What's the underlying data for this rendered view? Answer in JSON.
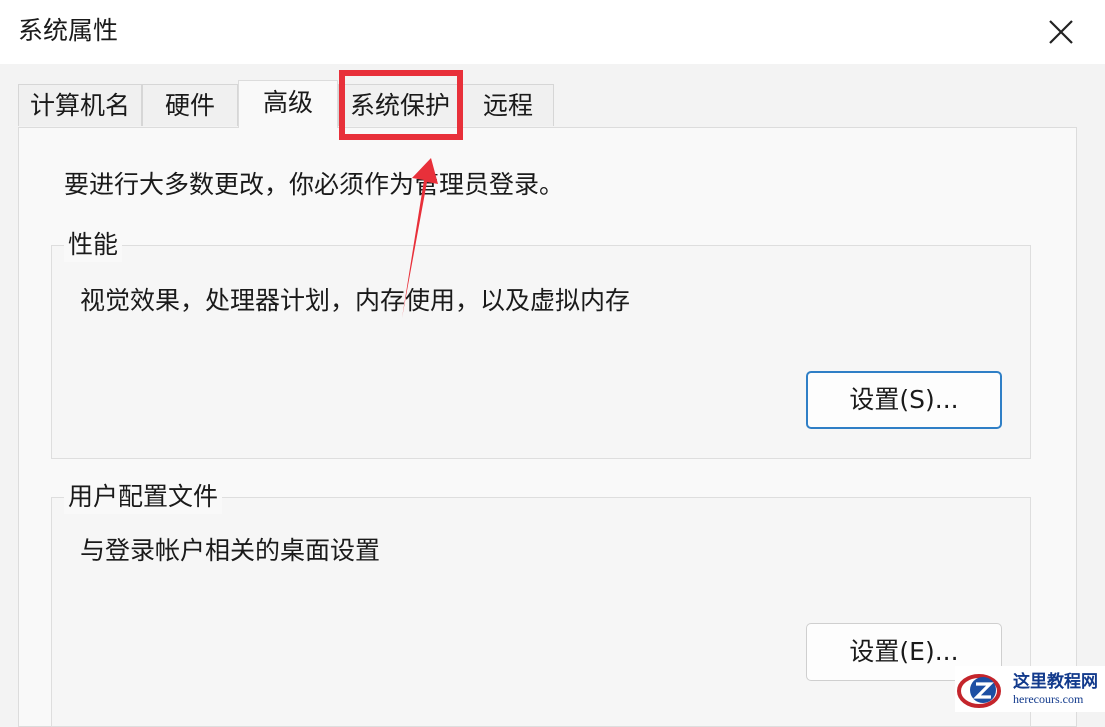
{
  "window": {
    "title": "系统属性",
    "close_icon": "close-icon"
  },
  "tabs": [
    {
      "label": "计算机名",
      "active": false
    },
    {
      "label": "硬件",
      "active": false
    },
    {
      "label": "高级",
      "active": true
    },
    {
      "label": "系统保护",
      "active": false,
      "highlighted": true
    },
    {
      "label": "远程",
      "active": false
    }
  ],
  "advanced": {
    "admin_note": "要进行大多数更改，你必须作为管理员登录。",
    "performance": {
      "title": "性能",
      "description": "视觉效果，处理器计划，内存使用，以及虚拟内存",
      "button_label": "设置(S)..."
    },
    "user_profiles": {
      "title": "用户配置文件",
      "description": "与登录帐户相关的桌面设置",
      "button_label": "设置(E)..."
    }
  },
  "annotation": {
    "color": "#e8303a"
  },
  "watermark": {
    "title": "这里教程网",
    "url": "herecours.com"
  }
}
